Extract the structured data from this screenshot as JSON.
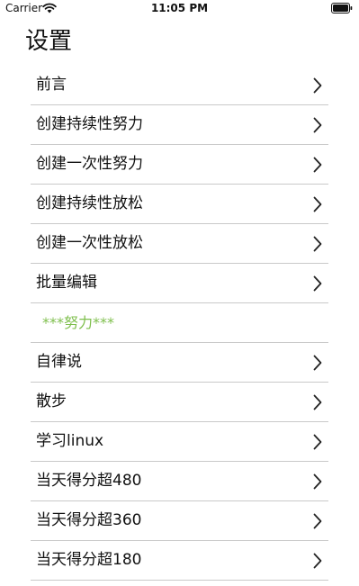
{
  "status_bar": {
    "carrier": "Carrier",
    "time": "11:05 PM"
  },
  "page": {
    "title": "设置"
  },
  "colors": {
    "section_header": "#7fbf4d",
    "separator": "#c9c9c9",
    "chevron": "#222222"
  },
  "list": {
    "items": [
      {
        "label": "前言",
        "type": "item"
      },
      {
        "label": "创建持续性努力",
        "type": "item"
      },
      {
        "label": "创建一次性努力",
        "type": "item"
      },
      {
        "label": "创建持续性放松",
        "type": "item"
      },
      {
        "label": "创建一次性放松",
        "type": "item"
      },
      {
        "label": "批量编辑",
        "type": "item"
      },
      {
        "label": "***努力***",
        "type": "section"
      },
      {
        "label": "自律说",
        "type": "item"
      },
      {
        "label": "散步",
        "type": "item"
      },
      {
        "label": "学习linux",
        "type": "item"
      },
      {
        "label": "当天得分超480",
        "type": "item"
      },
      {
        "label": "当天得分超360",
        "type": "item"
      },
      {
        "label": "当天得分超180",
        "type": "item"
      }
    ]
  }
}
